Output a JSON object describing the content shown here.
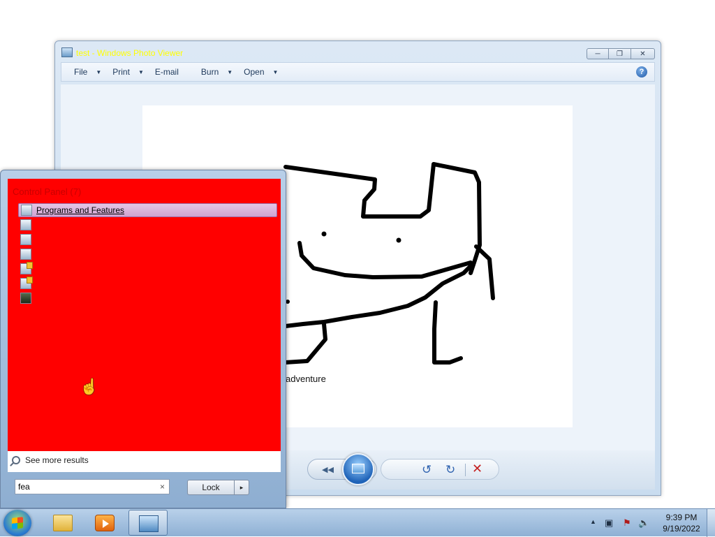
{
  "viewer": {
    "title": "test - Windows Photo Viewer",
    "menu": [
      {
        "label": "File",
        "has_arrow": true
      },
      {
        "label": "Print",
        "has_arrow": true
      },
      {
        "label": "E-mail",
        "has_arrow": false
      },
      {
        "label": "Burn",
        "has_arrow": true
      },
      {
        "label": "Open",
        "has_arrow": true
      }
    ],
    "help_icon": "?",
    "caption": "adventure"
  },
  "start_menu": {
    "header": "Control Panel (7)",
    "results": [
      {
        "label": "Programs and Features",
        "icon": "programs-icon"
      },
      {
        "label": "",
        "icon": "control-panel-icon"
      },
      {
        "label": "",
        "icon": "document-icon"
      },
      {
        "label": "",
        "icon": "document-icon"
      },
      {
        "label": "",
        "icon": "shield-settings-icon"
      },
      {
        "label": "",
        "icon": "shield-settings-icon"
      },
      {
        "label": "",
        "icon": "dark-screen-icon"
      }
    ],
    "see_more": "See more results",
    "search_value": "fea",
    "clear_glyph": "×",
    "lock_label": "Lock",
    "lock_arrow": "▸"
  },
  "taskbar": {
    "time": "9:39 PM",
    "date": "9/19/2022"
  },
  "colors": {
    "results_background": "#ff0000",
    "title_text": "#ffff00",
    "selected_row": "#cfa3d1"
  }
}
